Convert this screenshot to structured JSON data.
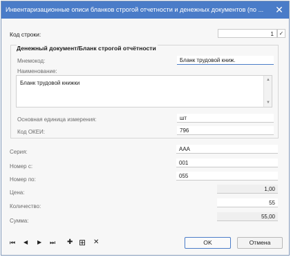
{
  "window": {
    "title": "Инвентаризационные описи бланков строгой отчетности и денежных документов (по ...",
    "close_glyph": "✕"
  },
  "row_code": {
    "label": "Код строки:",
    "value": "1",
    "check": "✓"
  },
  "group": {
    "title": "Денежный документ/Бланк строгой отчётности",
    "mnemocode_label": "Мнемокод:",
    "mnemocode_value": "Бланк трудовой книж.",
    "name_label": "Наименование:",
    "name_value": "Бланк трудовой книжки",
    "unit_label": "Основная единица измерения:",
    "unit_value": "шт",
    "okei_label": "Код ОКЕИ:",
    "okei_value": "796"
  },
  "fields": {
    "series_label": "Серия:",
    "series_value": "ААА",
    "num_from_label": "Номер с:",
    "num_from_value": "001",
    "num_to_label": "Номер по:",
    "num_to_value": "055",
    "price_label": "Цена:",
    "price_value": "1,00",
    "qty_label": "Количество:",
    "qty_value": "55",
    "sum_label": "Сумма:",
    "sum_value": "55,00"
  },
  "toolbar": {
    "first": "⏮",
    "prev": "◀",
    "next": "▶",
    "last": "⏭",
    "add": "✚",
    "add_boxed": "⊞",
    "delete": "✕"
  },
  "buttons": {
    "ok": "OK",
    "cancel": "Отмена"
  },
  "scroll": {
    "up": "▲",
    "down": "▼"
  }
}
